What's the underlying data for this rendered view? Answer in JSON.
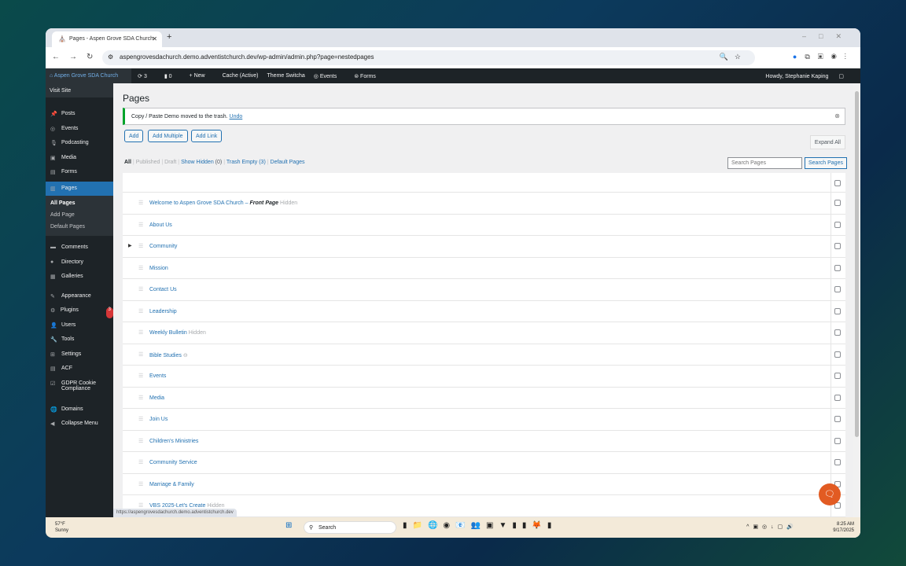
{
  "browser": {
    "tab_title": "Pages - Aspen Grove SDA Church",
    "url": "aspengrovesdachurch.demo.adventistchurch.dev/wp-admin/admin.php?page=nestedpages"
  },
  "adminbar": {
    "site": "Aspen Grove SDA Church",
    "updates": "3",
    "comments": "0",
    "new": "New",
    "cache": "Cache (Active)",
    "theme": "Theme Switcha",
    "events": "Events",
    "forms": "Forms",
    "howdy": "Howdy, Stephanie Kaping"
  },
  "sidebar": {
    "visit_site": "Visit Site",
    "items": [
      {
        "label": "Posts",
        "icon": "📌"
      },
      {
        "label": "Events",
        "icon": "◎"
      },
      {
        "label": "Podcasting",
        "icon": "🎙"
      },
      {
        "label": "Media",
        "icon": "▣"
      },
      {
        "label": "Forms",
        "icon": "▤"
      },
      {
        "label": "Pages",
        "icon": "▥"
      }
    ],
    "submenu": [
      "All Pages",
      "Add Page",
      "Default Pages"
    ],
    "items2": [
      {
        "label": "Comments",
        "icon": "▬"
      },
      {
        "label": "Directory",
        "icon": "●"
      },
      {
        "label": "Galleries",
        "icon": "▦"
      },
      {
        "label": "Appearance",
        "icon": "✎"
      },
      {
        "label": "Plugins",
        "icon": "⚙",
        "badge": "3"
      },
      {
        "label": "Users",
        "icon": "👤"
      },
      {
        "label": "Tools",
        "icon": "🔧"
      },
      {
        "label": "Settings",
        "icon": "⊞"
      },
      {
        "label": "ACF",
        "icon": "▤"
      },
      {
        "label": "GDPR Cookie Compliance",
        "icon": "☑"
      },
      {
        "label": "Domains",
        "icon": "🌐"
      },
      {
        "label": "Collapse Menu",
        "icon": "◀"
      }
    ]
  },
  "main": {
    "title": "Pages",
    "notice": "Copy / Paste Demo moved to the trash.",
    "undo": "Undo",
    "buttons": {
      "add": "Add",
      "add_multiple": "Add Multiple",
      "add_link": "Add Link",
      "expand_all": "Expand All",
      "search": "Search Pages"
    },
    "search_placeholder": "Search Pages",
    "filters": {
      "all": "All",
      "published": "Published",
      "draft": "Draft",
      "show_hidden": "Show Hidden",
      "hidden_count": "(0)",
      "trash": "Trash",
      "empty": "Empty (3)",
      "default_pages": "Default Pages"
    },
    "pages": [
      {
        "title": "Welcome to Aspen Grove SDA Church – ",
        "front": "Front Page",
        "hidden": "Hidden"
      },
      {
        "title": "About Us"
      },
      {
        "title": "Community",
        "children": true
      },
      {
        "title": "Mission"
      },
      {
        "title": "Contact Us"
      },
      {
        "title": "Leadership"
      },
      {
        "title": "Weekly Bulletin",
        "hidden": "Hidden"
      },
      {
        "title": "Bible Studies",
        "link": "⊖"
      },
      {
        "title": "Events"
      },
      {
        "title": "Media"
      },
      {
        "title": "Join Us"
      },
      {
        "title": "Children's Ministries"
      },
      {
        "title": "Community Service"
      },
      {
        "title": "Marriage & Family"
      },
      {
        "title": "VBS 2025-Let's Create",
        "hidden": "Hidden"
      }
    ]
  },
  "status_url": "https://aspengrovesdachurch.demo.adventistchurch.dev",
  "taskbar": {
    "temp": "57°F",
    "weather": "Sunny",
    "search": "Search",
    "time": "8:25 AM",
    "date": "9/17/2025"
  }
}
